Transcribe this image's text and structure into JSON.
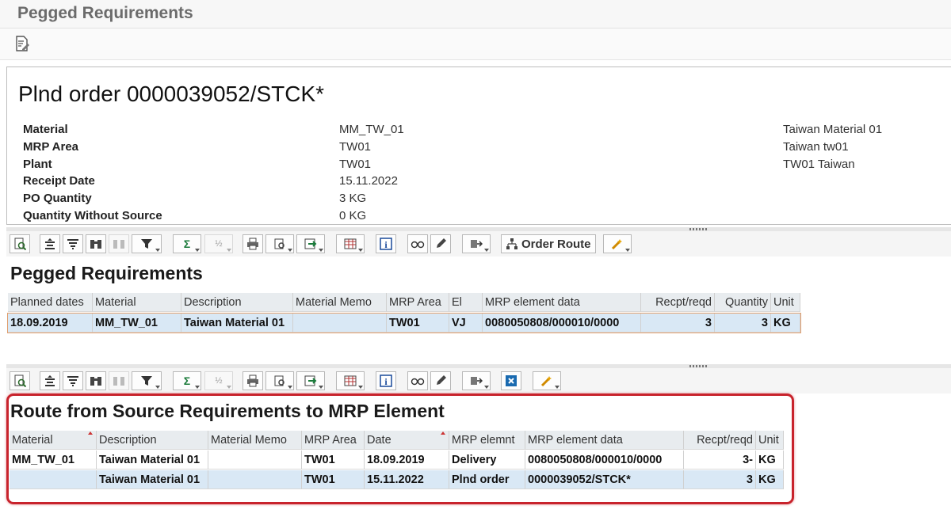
{
  "window": {
    "title": "Pegged Requirements"
  },
  "header": {
    "order_title": "Plnd order 0000039052/STCK*",
    "fields": [
      {
        "label": "Material",
        "value": "MM_TW_01",
        "desc": "Taiwan Material 01"
      },
      {
        "label": "MRP Area",
        "value": "TW01",
        "desc": "Taiwan tw01"
      },
      {
        "label": "Plant",
        "value": "TW01",
        "desc": "TW01 Taiwan"
      },
      {
        "label": "Receipt Date",
        "value": "15.11.2022",
        "desc": ""
      },
      {
        "label": "PO Quantity",
        "value": "3 KG",
        "desc": ""
      },
      {
        "label": "Quantity Without Source",
        "value": "0 KG",
        "desc": ""
      }
    ]
  },
  "toolbar": {
    "order_route_label": "Order Route"
  },
  "pegged": {
    "title": "Pegged Requirements",
    "columns": [
      "Planned dates",
      "Material",
      "Description",
      "Material Memo",
      "MRP Area",
      "El",
      "MRP element data",
      "Recpt/reqd",
      "Quantity",
      "Unit"
    ],
    "rows": [
      [
        "18.09.2019",
        "MM_TW_01",
        "Taiwan Material 01",
        "",
        "TW01",
        "VJ",
        "0080050808/000010/0000",
        "3",
        "3",
        "KG"
      ]
    ]
  },
  "route": {
    "title": "Route from Source Requirements to MRP Element",
    "columns": [
      "Material",
      "Description",
      "Material Memo",
      "MRP Area",
      "Date",
      "MRP elemnt",
      "MRP element data",
      "Recpt/reqd",
      "Unit"
    ],
    "rows": [
      [
        "MM_TW_01",
        "Taiwan Material 01",
        "",
        "TW01",
        "18.09.2019",
        "Delivery",
        "0080050808/000010/0000",
        "3-",
        "KG"
      ],
      [
        "",
        "Taiwan Material 01",
        "",
        "TW01",
        "15.11.2022",
        "Plnd order",
        "0000039052/STCK*",
        "3",
        "KG"
      ]
    ]
  },
  "colors": {
    "accent_outline": "#c8232c",
    "selected_row": "#d9e8f5",
    "header_bg": "#e8ecef"
  }
}
